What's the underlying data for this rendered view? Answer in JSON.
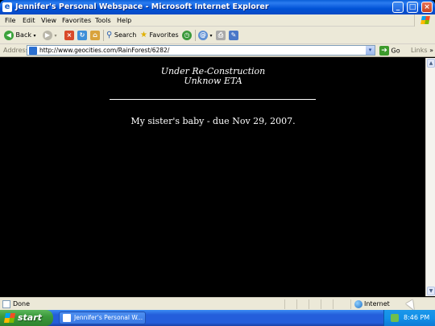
{
  "window": {
    "title": "Jennifer's Personal Webspace - Microsoft Internet Explorer",
    "minimize_glyph": "_",
    "maximize_glyph": "□",
    "close_glyph": "×"
  },
  "menu": {
    "items": [
      "File",
      "Edit",
      "View",
      "Favorites",
      "Tools",
      "Help"
    ]
  },
  "toolbar": {
    "back_label": "Back",
    "search_label": "Search",
    "favorites_label": "Favorites"
  },
  "address": {
    "label": "Address",
    "url": "http://www.geocities.com/RainForest/6282/",
    "go_label": "Go",
    "links_label": "Links"
  },
  "content": {
    "heading_line1": "Under Re-Construction",
    "heading_line2": "Unknow ETA",
    "baby_text": "My sister's baby - due Nov 29, 2007."
  },
  "status": {
    "text": "Done",
    "zone": "Internet"
  },
  "taskbar": {
    "start_label": "start",
    "task_label": "Jennifer's Personal W...",
    "clock": "8:46 PM"
  },
  "colors": {
    "page_background": "#000000",
    "page_text": "#ffffff",
    "titlebar": "#0a5fd8",
    "start_button": "#3c9a3c"
  },
  "icons": [
    "ie-icon",
    "back-icon",
    "forward-icon",
    "stop-icon",
    "refresh-icon",
    "home-icon",
    "search-icon",
    "favorites-icon",
    "history-icon",
    "mail-icon",
    "print-icon",
    "edit-icon",
    "page-icon",
    "go-arrow-icon",
    "internet-zone-icon",
    "windows-logo-icon"
  ]
}
